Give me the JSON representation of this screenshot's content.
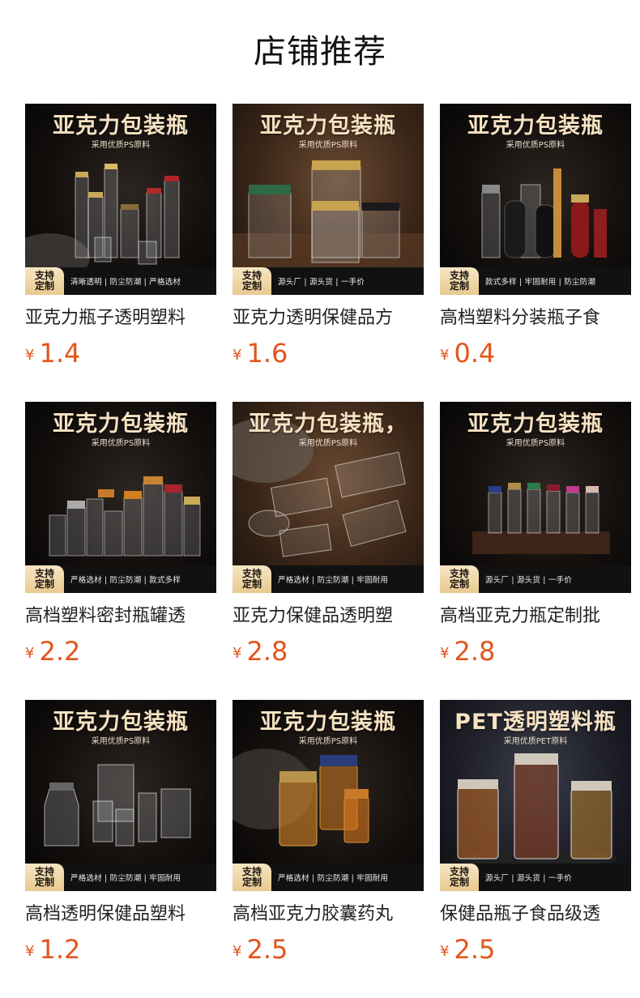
{
  "page": {
    "title": "店铺推荐"
  },
  "colors": {
    "price": "#e4541a",
    "badge": "#f3ddb0",
    "banner_text": "#f7e2c2"
  },
  "products": [
    {
      "banner_title": "亚克力包装瓶",
      "banner_sub": "采用优质PS原料",
      "badge": [
        "支持",
        "定制"
      ],
      "strip": "清晰透明 | 防尘防潮 | 严格选材",
      "name": "亚克力瓶子透明塑料",
      "currency": "¥",
      "price": "1.4"
    },
    {
      "banner_title": "亚克力包装瓶",
      "banner_sub": "采用优质PS原料",
      "badge": [
        "支持",
        "定制"
      ],
      "strip": "源头厂 | 源头货 | 一手价",
      "name": "亚克力透明保健品方",
      "currency": "¥",
      "price": "1.6"
    },
    {
      "banner_title": "亚克力包装瓶",
      "banner_sub": "采用优质PS原料",
      "badge": [
        "支持",
        "定制"
      ],
      "strip": "款式多样 | 牢固耐用 | 防尘防潮",
      "name": "高档塑料分装瓶子食",
      "currency": "¥",
      "price": "0.4"
    },
    {
      "banner_title": "亚克力包装瓶",
      "banner_sub": "采用优质PS原料",
      "badge": [
        "支持",
        "定制"
      ],
      "strip": "严格选材 | 防尘防潮 | 款式多样",
      "name": "高档塑料密封瓶罐透",
      "currency": "¥",
      "price": "2.2"
    },
    {
      "banner_title": "亚克力包装瓶，",
      "banner_sub": "采用优质PS原料",
      "badge": [
        "支持",
        "定制"
      ],
      "strip": "严格选材 | 防尘防潮 | 牢固耐用",
      "name": "亚克力保健品透明塑",
      "currency": "¥",
      "price": "2.8"
    },
    {
      "banner_title": "亚克力包装瓶",
      "banner_sub": "采用优质PS原料",
      "badge": [
        "支持",
        "定制"
      ],
      "strip": "源头厂 | 源头货 | 一手价",
      "name": "高档亚克力瓶定制批",
      "currency": "¥",
      "price": "2.8"
    },
    {
      "banner_title": "亚克力包装瓶",
      "banner_sub": "采用优质PS原料",
      "badge": [
        "支持",
        "定制"
      ],
      "strip": "严格选材 | 防尘防潮 | 牢固耐用",
      "name": "高档透明保健品塑料",
      "currency": "¥",
      "price": "1.2"
    },
    {
      "banner_title": "亚克力包装瓶",
      "banner_sub": "采用优质PS原料",
      "badge": [
        "支持",
        "定制"
      ],
      "strip": "严格选材 | 防尘防潮 | 牢固耐用",
      "name": "高档亚克力胶囊药丸",
      "currency": "¥",
      "price": "2.5"
    },
    {
      "banner_title": "PET透明塑料瓶",
      "banner_sub": "采用优质PET原料",
      "badge": [
        "支持",
        "定制"
      ],
      "strip": "源头厂 | 源头货 | 一手价",
      "name": "保健品瓶子食品级透",
      "currency": "¥",
      "price": "2.5"
    }
  ]
}
